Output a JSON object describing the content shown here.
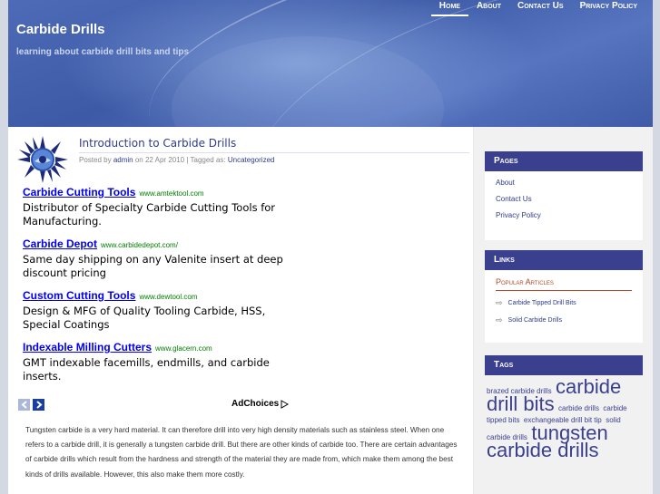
{
  "header": {
    "site_title": "Carbide Drills",
    "tagline": "learning about carbide drill bits and tips",
    "nav": [
      "Home",
      "About",
      "Contact Us",
      "Privacy Policy"
    ]
  },
  "post": {
    "title": "Introduction to Carbide Drills",
    "meta_prefix": "Posted by",
    "author": "admin",
    "meta_date": "on 22 Apr 2010 | Tagged as:",
    "category": "Uncategorized",
    "body": "Tungsten carbide is a very hard material. It can therefore drill into very high density materials such as stainless steel. When one refers to a carbide drill, it is generally a tungsten carbide drill. But there are other kinds of carbide too. There are certain advantages of carbide drills which result from the hardness and strength of the material they are made from, which make them among the best kinds of drills available. However, this also make them more costly."
  },
  "ads": [
    {
      "title": "Carbide Cutting Tools",
      "url": "www.amtektool.com",
      "desc": "Distributor of Specialty Carbide Cutting Tools for Manufacturing."
    },
    {
      "title": "Carbide Depot",
      "url": "www.carbidedepot.com/",
      "desc": "Same day shipping on any Valenite insert at deep discount pricing"
    },
    {
      "title": "Custom Cutting Tools",
      "url": "www.dewtool.com",
      "desc": "Design & MFG of Quality Tooling Carbide, HSS, Special Coatings"
    },
    {
      "title": "Indexable Milling Cutters",
      "url": "www.glacern.com",
      "desc": "GMT indexable facemills, endmills, and carbide inserts."
    }
  ],
  "adchoices": "AdChoices",
  "sidebar": {
    "pages_title": "Pages",
    "pages": [
      "About",
      "Contact Us",
      "Privacy Policy"
    ],
    "links_title": "Links",
    "popular_title": "Popular Articles",
    "popular": [
      "Carbide Tipped Drill Bits",
      "Solid Carbide Drills"
    ],
    "tags_title": "Tags",
    "tags": [
      {
        "text": "brazed carbide drills",
        "size": "s"
      },
      {
        "text": "carbide drill bits",
        "size": "l"
      },
      {
        "text": "carbide drills",
        "size": "s"
      },
      {
        "text": "carbide tipped bits",
        "size": "s"
      },
      {
        "text": "exchangeable drill bit tip",
        "size": "s"
      },
      {
        "text": "solid carbide drills",
        "size": "s"
      },
      {
        "text": "tungsten carbide drills",
        "size": "l"
      }
    ]
  },
  "colors": {
    "accent": "#3a3f8e",
    "link": "#2e3b8c",
    "ad_link": "#0000ee",
    "ad_url": "#008000",
    "header_blue": "#4e6bb8"
  }
}
